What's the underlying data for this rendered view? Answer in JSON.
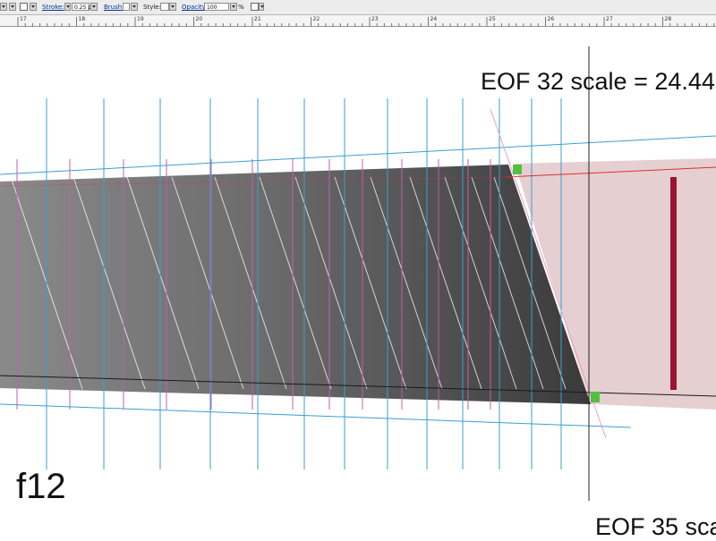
{
  "toolbar": {
    "stroke_label": "Stroke:",
    "stroke_value": "0.25 p",
    "brush_label": "Brush:",
    "style_label": "Style:",
    "opacity_label": "Opacity:",
    "opacity_value": "100",
    "opacity_unit": "%"
  },
  "ruler": {
    "numbers": [
      "17",
      "18",
      "19",
      "20",
      "21",
      "22",
      "23",
      "24",
      "25",
      "26",
      "27",
      "28"
    ]
  },
  "canvas": {
    "label_top": "EOF 32 scale = 24.44",
    "label_bottom": "EOF 35 sca",
    "frame_label": "f12"
  },
  "colors": {
    "guide_cyan": "#3a9fd0",
    "guide_magenta": "#c060b0",
    "selection_green": "#55c040",
    "marker_red": "#9a1530",
    "pink_region": "#e5cfd1",
    "red_line": "#e03030"
  }
}
